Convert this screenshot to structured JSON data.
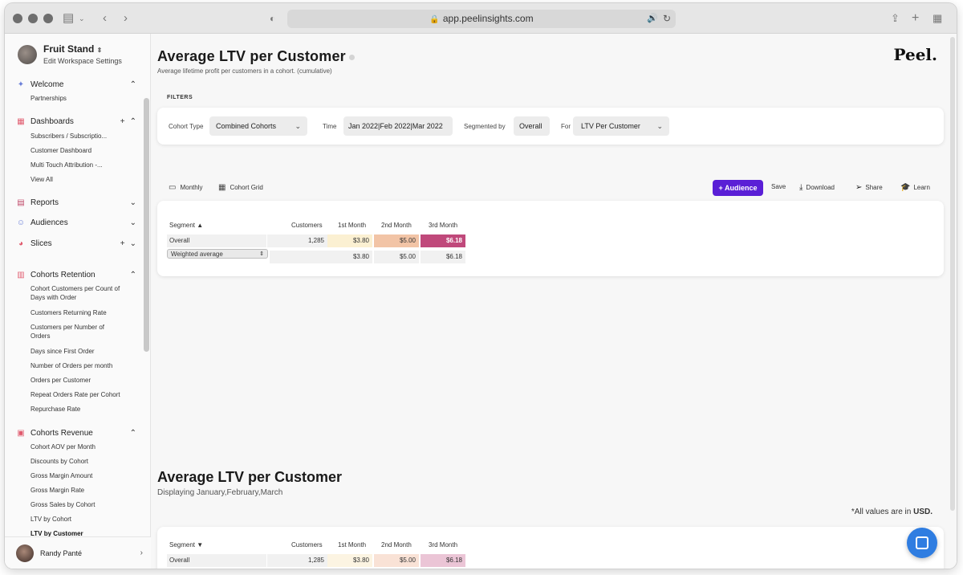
{
  "browser": {
    "url": "app.peelinsights.com"
  },
  "workspace": {
    "name": "Fruit Stand",
    "subtitle": "Edit Workspace Settings"
  },
  "sidebar": {
    "welcome": {
      "label": "Welcome",
      "items": [
        "Partnerships"
      ]
    },
    "dashboards": {
      "label": "Dashboards",
      "items": [
        "Subscribers / Subscriptio...",
        "Customer Dashboard",
        "Multi Touch Attribution -...",
        "View All"
      ]
    },
    "reports": {
      "label": "Reports"
    },
    "audiences": {
      "label": "Audiences"
    },
    "slices": {
      "label": "Slices"
    },
    "cohorts_retention": {
      "label": "Cohorts Retention",
      "items": [
        "Cohort Customers per Count of Days with Order",
        "Customers Returning Rate",
        "Customers per Number of Orders",
        "Days since First Order",
        "Number of Orders per month",
        "Orders per Customer",
        "Repeat Orders Rate per Cohort",
        "Repurchase Rate"
      ]
    },
    "cohorts_revenue": {
      "label": "Cohorts Revenue",
      "items": [
        "Cohort AOV per Month",
        "Discounts by Cohort",
        "Gross Margin Amount",
        "Gross Margin Rate",
        "Gross Sales by Cohort",
        "LTV by Cohort",
        "LTV by Customer"
      ]
    },
    "user": {
      "name": "Randy Panté"
    }
  },
  "header": {
    "title": "Average LTV per Customer",
    "subtitle": "Average lifetime profit per customers in a cohort. (cumulative)",
    "brand": "Peel."
  },
  "filters": {
    "section_label": "FILTERS",
    "cohort_type_label": "Cohort Type",
    "cohort_type_value": "Combined Cohorts",
    "time_label": "Time",
    "time_value": "Jan 2022|Feb 2022|Mar 2022",
    "segmented_label": "Segmented by",
    "segmented_value": "Overall",
    "for_label": "For",
    "for_value": "LTV Per Customer"
  },
  "toolbar": {
    "monthly": "Monthly",
    "cohort_grid": "Cohort Grid",
    "audience": "Audience",
    "save": "Save",
    "download": "Download",
    "share": "Share",
    "learn": "Learn"
  },
  "table": {
    "headers": [
      "Segment ▲",
      "Customers",
      "1st Month",
      "2nd Month",
      "3rd Month"
    ],
    "rows": [
      {
        "segment": "Overall",
        "customers": "1,285",
        "m1": "$3.80",
        "m2": "$5.00",
        "m3": "$6.18"
      }
    ],
    "weighted": {
      "label": "Weighted average",
      "m1": "$3.80",
      "m2": "$5.00",
      "m3": "$6.18"
    },
    "heat_colors": {
      "m1": "#fbf0d2",
      "m2": "#f2c4a6",
      "m3": "#c0497b"
    }
  },
  "section2": {
    "title": "Average LTV per Customer",
    "subtitle": "Displaying January,February,March",
    "note_prefix": "*All values are in ",
    "note_currency": "USD.",
    "headers": [
      "Segment ▼",
      "Customers",
      "1st Month",
      "2nd Month",
      "3rd Month"
    ],
    "row": {
      "segment": "Overall",
      "customers": "1,285",
      "m1": "$3.80",
      "m2": "$5.00",
      "m3": "$6.18"
    },
    "heat_colors": {
      "m1": "#fcf4e2",
      "m2": "#f9e2d6",
      "m3": "#ebc5d6"
    }
  },
  "colors": {
    "accent": "#5a1fd6",
    "chat": "#2f7de1"
  }
}
